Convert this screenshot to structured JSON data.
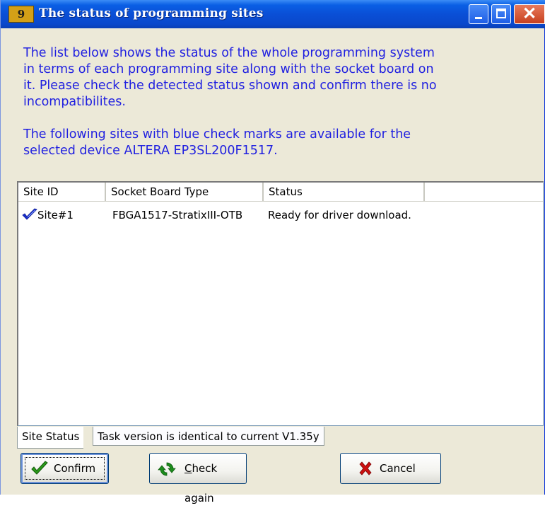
{
  "window": {
    "title": "The status of programming sites",
    "app_icon_text": "9",
    "close_glyph": "✕"
  },
  "description": {
    "paragraph1": "The list below shows the status of the whole programming system in terms of each programming site along with the socket board on it. Please check the detected status shown and confirm there is no incompatibilites.",
    "paragraph2": "The following sites with blue check marks are available for the selected device ALTERA EP3SL200F1517."
  },
  "table": {
    "columns": [
      "Site ID",
      "Socket Board Type",
      "Status"
    ],
    "rows": [
      {
        "site_id": "Site#1",
        "socket_board_type": "FBGA1517-StratixIII-OTB",
        "status": "Ready for driver download.",
        "checked": true
      }
    ]
  },
  "tabs": [
    {
      "label": "Site Status",
      "active": true
    },
    {
      "label": "Task version is identical to current V1.35y",
      "active": false
    }
  ],
  "buttons": {
    "confirm": "Confirm",
    "check_again_accel": "C",
    "check_again_rest": "heck again",
    "cancel": "Cancel"
  },
  "colors": {
    "title_bar": "#0a4fd6",
    "description_text": "#1f1fe0",
    "check_mark": "#1a2fd0",
    "cancel_x": "#cc1010",
    "confirm_check": "#2a9a1a",
    "refresh_icon": "#1c8c1c"
  },
  "icons": [
    "app-icon",
    "minimize-icon",
    "maximize-icon",
    "close-icon",
    "check-mark-icon",
    "confirm-check-icon",
    "refresh-icon",
    "cancel-x-icon"
  ]
}
